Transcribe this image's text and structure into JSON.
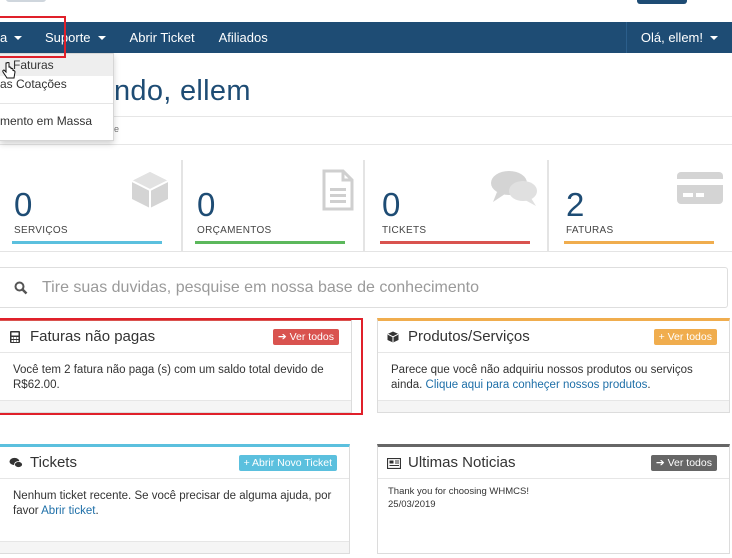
{
  "navbar": {
    "first_label": "a",
    "support_label": "Suporte",
    "open_ticket_label": "Abrir Ticket",
    "affiliates_label": "Afiliados",
    "user_label": "Olá, ellem!"
  },
  "dropdown": {
    "items": [
      "Faturas",
      "as Cotações",
      "mento em Massa"
    ]
  },
  "header": {
    "welcome": "ndo, ellem",
    "crumb": "e"
  },
  "stats": [
    {
      "value": "0",
      "label": "SERVIÇOS",
      "color": "#5bc0de",
      "icon": "cube-icon"
    },
    {
      "value": "0",
      "label": "ORÇAMENTOS",
      "color": "#5cb85c",
      "icon": "document-icon"
    },
    {
      "value": "0",
      "label": "TICKETS",
      "color": "#d9534f",
      "icon": "chat-bubbles-icon"
    },
    {
      "value": "2",
      "label": "FATURAS",
      "color": "#f0ad4e",
      "icon": "credit-card-icon"
    }
  ],
  "search": {
    "placeholder": "Tire suas duvidas, pesquise em nossa base de conhecimento"
  },
  "panels": {
    "invoices": {
      "title": "Faturas não pagas",
      "button": "Ver todos",
      "body": "Você tem 2 fatura não paga (s) com um saldo total devido de R$62.00."
    },
    "products": {
      "title": "Produtos/Serviços",
      "button": "Ver todos",
      "body_text": "Parece que você não adquiriu nossos produtos ou serviços ainda. ",
      "body_link": "Clique aqui para conheçer nossos produtos",
      "body_end": "."
    },
    "tickets": {
      "title": "Tickets",
      "button": "Abrir Novo Ticket",
      "body_text": "Nenhum ticket recente. Se você precisar de alguma ajuda, por favor ",
      "body_link": "Abrir ticket",
      "body_end": "."
    },
    "news": {
      "title": "Ultimas Noticias",
      "button": "Ver todos",
      "item_text": "Thank you for choosing WHMCS!",
      "item_date": "25/03/2019"
    }
  },
  "colors": {
    "navbar": "#1e4c74",
    "accent_red": "#d9534f",
    "accent_orange": "#f0ad4e",
    "accent_blue": "#5bc0de",
    "accent_gray": "#666666"
  }
}
